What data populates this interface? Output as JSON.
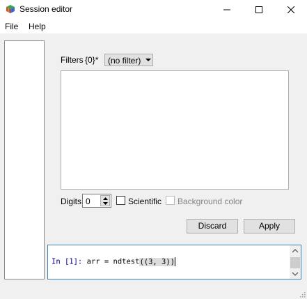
{
  "window": {
    "title": "Session editor"
  },
  "menubar": {
    "file": "File",
    "help": "Help"
  },
  "filters": {
    "label": "Filters",
    "value": "{0}*",
    "dropdown_selected": "(no filter)"
  },
  "options": {
    "digits_label": "Digits",
    "digits_value": "0",
    "scientific_label": "Scientific",
    "scientific_checked": false,
    "background_color_label": "Background color",
    "background_color_checked": false,
    "background_color_enabled": false
  },
  "buttons": {
    "discard": "Discard",
    "apply": "Apply"
  },
  "console": {
    "prompt": "In [1]:",
    "code_before": " arr = ndtest",
    "code_bracketed": "((3, 3))",
    "prompt_color": "#000080"
  },
  "icons": {
    "app": "multicolor-cube-icon",
    "minimize": "minimize-icon",
    "maximize": "maximize-icon",
    "close": "close-icon"
  }
}
